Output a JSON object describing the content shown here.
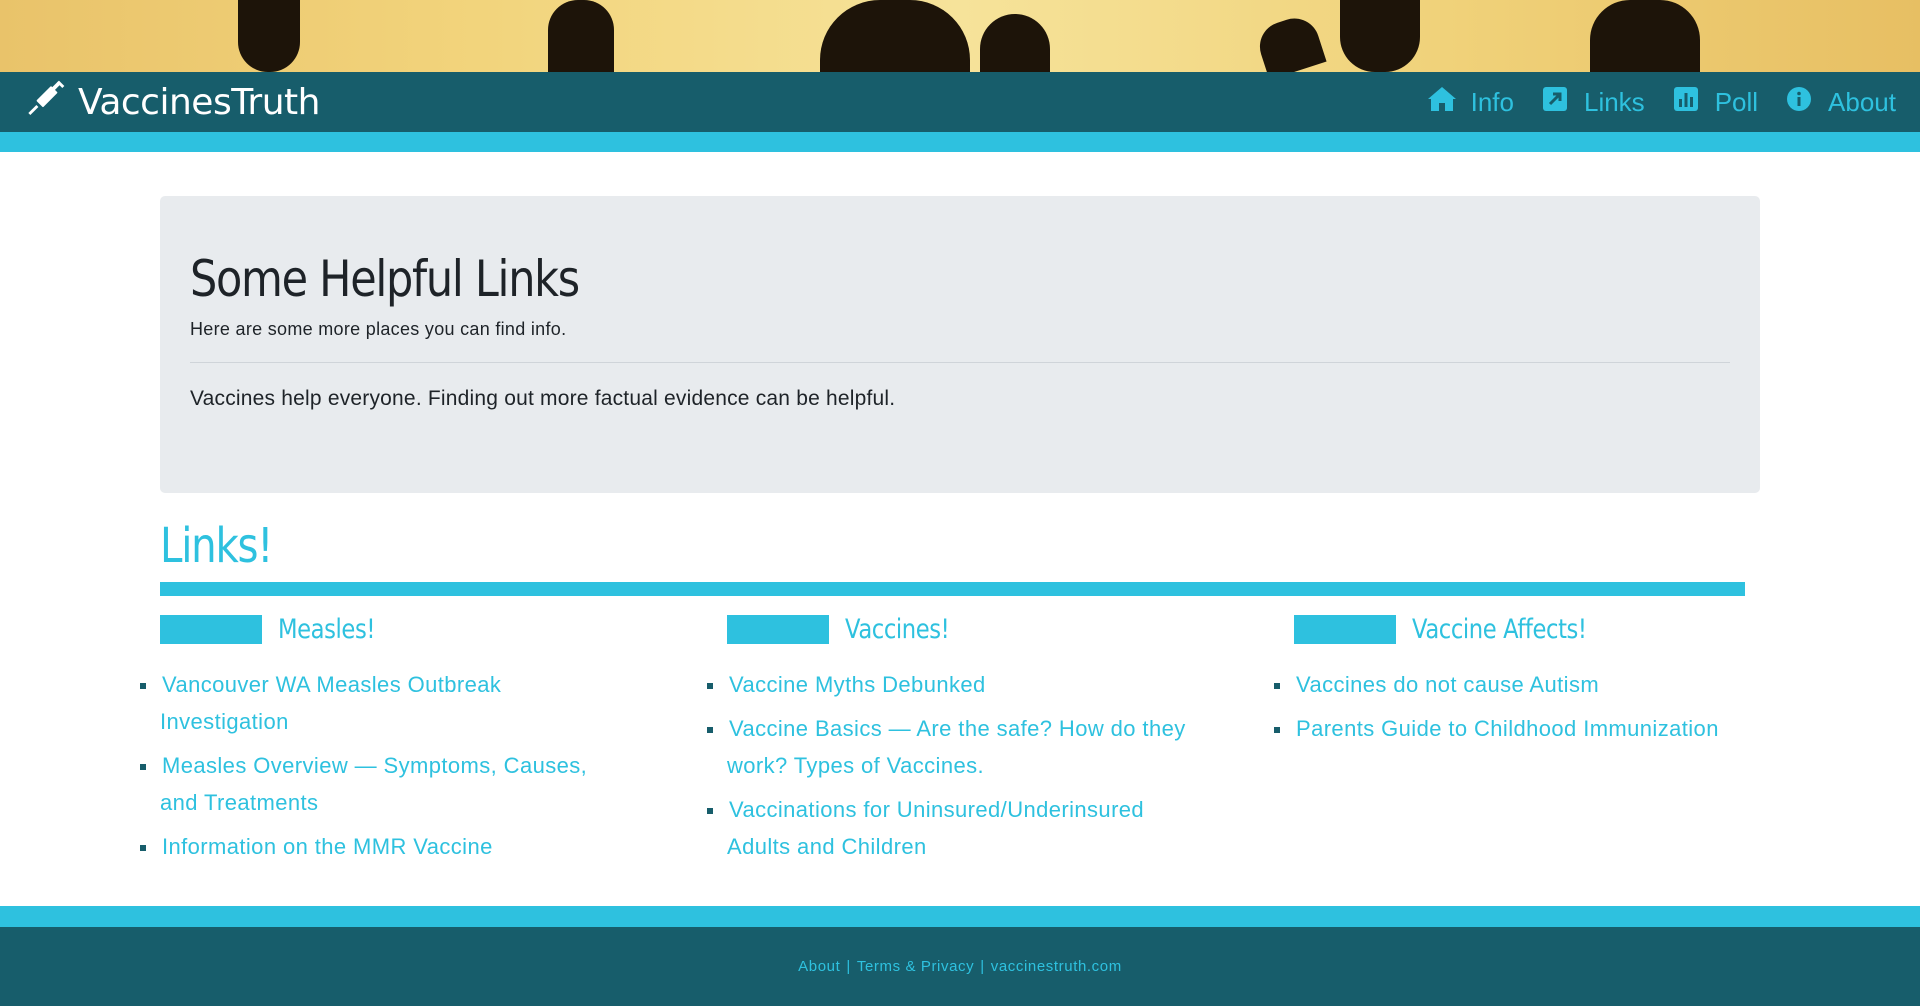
{
  "brand": {
    "name": "VaccinesTruth",
    "icon": "syringe-icon"
  },
  "nav": [
    {
      "label": "Info",
      "icon": "home-icon"
    },
    {
      "label": "Links",
      "icon": "external-link-icon"
    },
    {
      "label": "Poll",
      "icon": "bar-chart-icon"
    },
    {
      "label": "About",
      "icon": "info-icon"
    }
  ],
  "jumbotron": {
    "title": "Some Helpful Links",
    "subtitle": "Here are some more places you can find info.",
    "body": "Vaccines help everyone. Finding out more factual evidence can be helpful."
  },
  "links": {
    "title": "Links!",
    "columns": [
      {
        "heading": "Measles!",
        "items": [
          "Vancouver WA Measles Outbreak Investigation",
          "Measles Overview — Symptoms, Causes, and Treatments",
          "Information on the MMR Vaccine"
        ]
      },
      {
        "heading": "Vaccines!",
        "items": [
          "Vaccine Myths Debunked",
          "Vaccine Basics — Are the safe? How do they work? Types of Vaccines.",
          "Vaccinations for Uninsured/Underinsured Adults and Children"
        ]
      },
      {
        "heading": "Vaccine Affects!",
        "items": [
          "Vaccines do not cause Autism",
          "Parents Guide to Childhood Immunization"
        ]
      }
    ]
  },
  "footer": {
    "about": "About",
    "terms": "Terms & Privacy",
    "site": "vaccinestruth.com",
    "separator": "|"
  },
  "colors": {
    "navbar": "#175d6b",
    "accent": "#2ec1df",
    "jumbotron": "#e8ebee",
    "text": "#1e2328"
  }
}
